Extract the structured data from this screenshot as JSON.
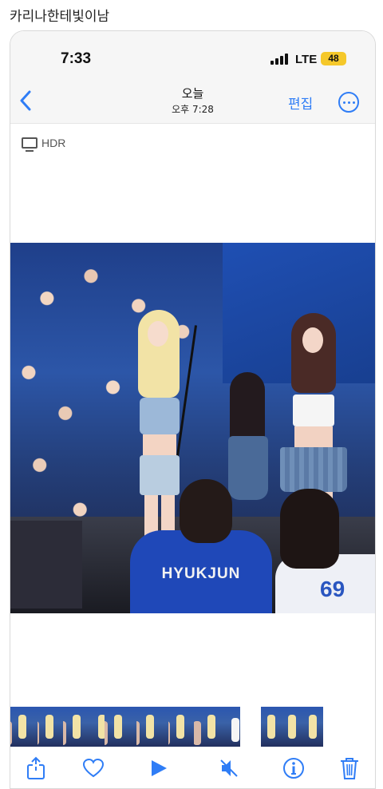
{
  "post": {
    "title": "카리나한테빛이남"
  },
  "status_bar": {
    "time": "7:33",
    "network": "LTE",
    "battery": "48"
  },
  "nav": {
    "title": "오늘",
    "subtitle": "오후 7:28",
    "edit_label": "편집",
    "back_icon": "chevron-left-icon",
    "more_icon": "ellipsis-circle-icon"
  },
  "photo_info": {
    "badge": "HDR",
    "badge_icon": "display-icon"
  },
  "photo": {
    "jersey_text": "HYUKJUN",
    "jersey_number": "69"
  },
  "thumbnails": {
    "count": 12,
    "selected_index": 7
  },
  "toolbar": {
    "items": [
      "share-icon",
      "heart-icon",
      "play-icon",
      "mute-icon",
      "info-icon",
      "trash-icon"
    ]
  },
  "colors": {
    "accent": "#2f7df6",
    "battery": "#f5c82a"
  }
}
